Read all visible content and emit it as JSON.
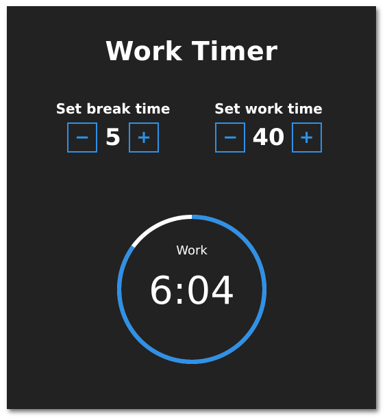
{
  "app": {
    "title": "Work Timer"
  },
  "break_setter": {
    "label": "Set break time",
    "decrement_label": "−",
    "increment_label": "+",
    "value": "5"
  },
  "work_setter": {
    "label": "Set work time",
    "decrement_label": "−",
    "increment_label": "+",
    "value": "40"
  },
  "timer": {
    "mode": "Work",
    "time": "6:04",
    "remaining_fraction": 0.85,
    "ring_color": "#2f91e8",
    "elapsed_color": "#ffffff"
  },
  "colors": {
    "background": "#222222",
    "accent": "#2f91e8",
    "text": "#ffffff"
  }
}
